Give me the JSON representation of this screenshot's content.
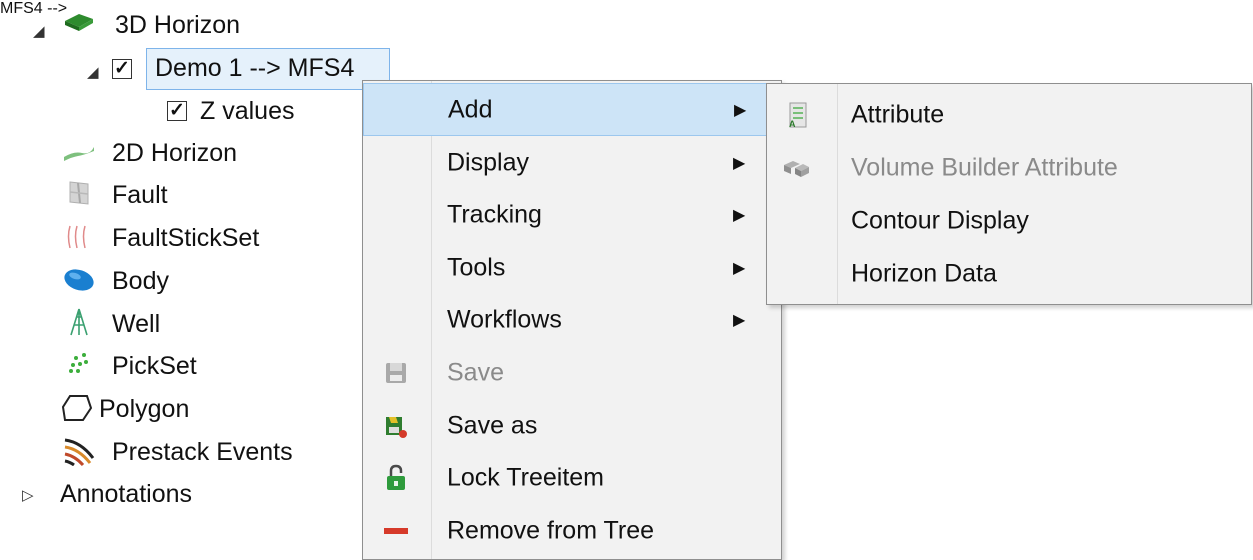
{
  "tree": {
    "horizon3d": "3D Horizon",
    "demo": "Demo 1 --> MFS4",
    "zvalues": "Z values",
    "horizon2d": "2D Horizon",
    "fault": "Fault",
    "faultstickset": "FaultStickSet",
    "body": "Body",
    "well": "Well",
    "pickset": "PickSet",
    "polygon": "Polygon",
    "prestack": "Prestack Events",
    "annotations": "Annotations"
  },
  "context_menu": {
    "items": [
      {
        "label": "Add",
        "submenu": true,
        "icon": ""
      },
      {
        "label": "Display",
        "submenu": true,
        "icon": ""
      },
      {
        "label": "Tracking",
        "submenu": true,
        "icon": ""
      },
      {
        "label": "Tools",
        "submenu": true,
        "icon": ""
      },
      {
        "label": "Workflows",
        "submenu": true,
        "icon": ""
      },
      {
        "label": "Save",
        "disabled": true,
        "icon": "save-icon"
      },
      {
        "label": "Save as",
        "icon": "save-as-icon"
      },
      {
        "label": "Lock Treeitem",
        "icon": "lock-icon"
      },
      {
        "label": "Remove from Tree",
        "icon": "remove-icon"
      }
    ],
    "submenu_arrow": "▶"
  },
  "add_submenu": {
    "items": [
      {
        "label": "Attribute",
        "icon": "attribute-icon"
      },
      {
        "label": "Volume Builder Attribute",
        "disabled": true,
        "icon": "volume-builder-icon"
      },
      {
        "label": "Contour Display"
      },
      {
        "label": "Horizon Data"
      }
    ]
  },
  "colors": {
    "highlight": "#cde4f7",
    "menu_bg": "#f2f2f2",
    "selection": "#e5f1fb"
  }
}
